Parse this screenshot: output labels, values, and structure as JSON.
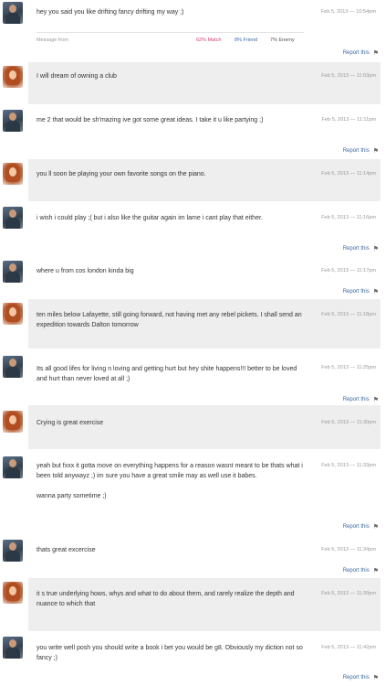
{
  "report_label": "Report this",
  "flag_icon": "flag-icon",
  "first_meta": {
    "label": "Message from",
    "match": "62% Match",
    "friend": "8% Friend",
    "enemy": "7% Enemy"
  },
  "messages": [
    {
      "sender": "male",
      "text": "hey you said you like drifting fancy drifting my way ;)",
      "time": "Feb 5, 2013 — 10:54pm"
    },
    {
      "sender": "female",
      "text": "I will dream of owning a club",
      "time": "Feb 5, 2013 — 11:03pm"
    },
    {
      "sender": "male",
      "text": "me 2 that would be sh'mazing ive got some great ideas. I take it u like partying ;)",
      "time": "Feb 5, 2013 — 11:11pm"
    },
    {
      "sender": "female",
      "text": "you ll soon be playing your own favorite songs on the piano.",
      "time": "Feb 5, 2013 — 11:14pm"
    },
    {
      "sender": "male",
      "text": "i wish i could play ;( but i also like the guitar again im lame i cant play that either.",
      "time": "Feb 5, 2013 — 11:16pm"
    },
    {
      "sender": "male",
      "text": "where u from cos london kinda big",
      "time": "Feb 5, 2013 — 11:17pm"
    },
    {
      "sender": "female",
      "text": "ten miles below Lafayette, still going forward, not having met any rebel pickets. I shall send an expedition towards Dalton tomorrow",
      "time": "Feb 5, 2013 — 11:18pm"
    },
    {
      "sender": "male",
      "text": "Its all good lifes for living n loving and getting hurt but hey shite happens!!! better to be loved and hurt than never loved at all ;)",
      "time": "Feb 5, 2013 — 11:25pm"
    },
    {
      "sender": "female",
      "text": "Crying is great exercise",
      "time": "Feb 5, 2013 — 11:30pm"
    },
    {
      "sender": "male",
      "text": "yeah but fxxx it gotta move on everything happens for a reason wasnt meant to be thats what i been told anywayz ;) im sure you have a great smile may as well use it babes.\n\nwanna party sometime ;)",
      "time": "Feb 5, 2013 — 11:33pm"
    },
    {
      "sender": "male",
      "text": "thats great excercise",
      "time": "Feb 5, 2013 — 11:34pm"
    },
    {
      "sender": "female",
      "text": "it s true underlying hows, whys and what to do about them, and rarely realize the depth and nuance to which that",
      "time": "Feb 5, 2013 — 11:39pm"
    },
    {
      "sender": "male",
      "text": "you write well posh you should write a book i bet you would be g8. Obviously my diction not so fancy ;)",
      "time": "Feb 5, 2013 — 11:42pm"
    }
  ]
}
